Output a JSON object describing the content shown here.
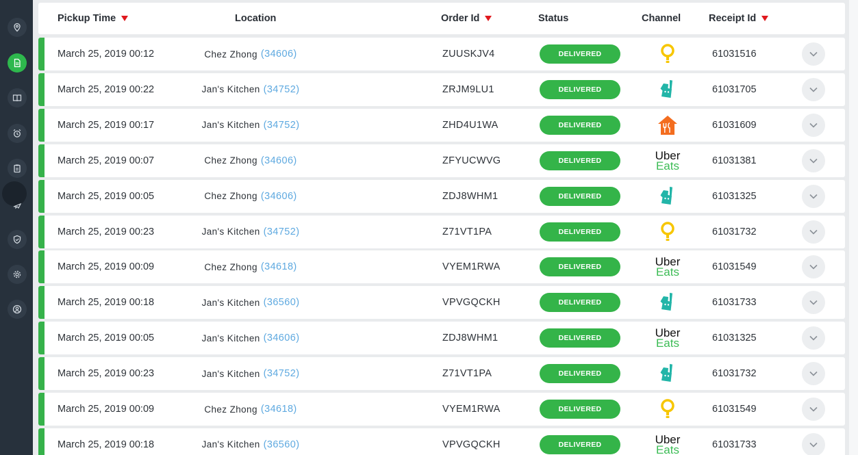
{
  "columns": {
    "pickup_time": "Pickup Time",
    "location": "Location",
    "order_id": "Order Id",
    "status": "Status",
    "channel": "Channel",
    "receipt_id": "Receipt Id"
  },
  "sidebar": {
    "items": [
      {
        "name": "location-pin-icon"
      },
      {
        "name": "orders-document-icon",
        "active": true
      },
      {
        "name": "menu-book-icon"
      },
      {
        "name": "alarm-clock-icon"
      },
      {
        "name": "clipboard-icon"
      },
      {
        "name": "plane-icon"
      },
      {
        "name": "shield-icon"
      },
      {
        "name": "settings-gear-icon"
      },
      {
        "name": "user-account-icon"
      }
    ]
  },
  "colors": {
    "accent_green": "#36b24a",
    "status_green": "#34b449",
    "link_blue": "#5ea9e0",
    "sort_red": "#e0191e",
    "postmates_yellow": "#f7c600",
    "deliveroo_teal": "#22b5a8",
    "thuisbezorgd_orange": "#f36d1f"
  },
  "orders": [
    {
      "time": "March 25, 2019 00:12",
      "location": "Chez Zhong",
      "location_id": "(34606)",
      "order_id": "ZUUSKJV4",
      "status": "DELIVERED",
      "channel": "postmates",
      "receipt_id": "61031516"
    },
    {
      "time": "March 25, 2019 00:22",
      "location": "Jan's Kitchen",
      "location_id": "(34752)",
      "order_id": "ZRJM9LU1",
      "status": "DELIVERED",
      "channel": "deliveroo",
      "receipt_id": "61031705"
    },
    {
      "time": "March 25, 2019 00:17",
      "location": "Jan's Kitchen",
      "location_id": "(34752)",
      "order_id": "ZHD4U1WA",
      "status": "DELIVERED",
      "channel": "thuisbezorgd",
      "receipt_id": "61031609"
    },
    {
      "time": "March 25, 2019 00:07",
      "location": "Chez Zhong",
      "location_id": "(34606)",
      "order_id": "ZFYUCWVG",
      "status": "DELIVERED",
      "channel": "ubereats",
      "receipt_id": "61031381"
    },
    {
      "time": "March 25, 2019 00:05",
      "location": "Chez Zhong",
      "location_id": "(34606)",
      "order_id": "ZDJ8WHM1",
      "status": "DELIVERED",
      "channel": "deliveroo",
      "receipt_id": "61031325"
    },
    {
      "time": "March 25, 2019 00:23",
      "location": "Jan's Kitchen",
      "location_id": "(34752)",
      "order_id": "Z71VT1PA",
      "status": "DELIVERED",
      "channel": "postmates",
      "receipt_id": "61031732"
    },
    {
      "time": "March 25, 2019 00:09",
      "location": "Chez Zhong",
      "location_id": "(34618)",
      "order_id": "VYEM1RWA",
      "status": "DELIVERED",
      "channel": "ubereats",
      "receipt_id": "61031549"
    },
    {
      "time": "March 25, 2019 00:18",
      "location": "Jan's Kitchen",
      "location_id": "(36560)",
      "order_id": "VPVGQCKH",
      "status": "DELIVERED",
      "channel": "deliveroo",
      "receipt_id": "61031733"
    },
    {
      "time": "March 25, 2019 00:05",
      "location": "Jan's Kitchen",
      "location_id": "(34606)",
      "order_id": "ZDJ8WHM1",
      "status": "DELIVERED",
      "channel": "ubereats",
      "receipt_id": "61031325"
    },
    {
      "time": "March 25, 2019 00:23",
      "location": "Jan's Kitchen",
      "location_id": "(34752)",
      "order_id": "Z71VT1PA",
      "status": "DELIVERED",
      "channel": "deliveroo",
      "receipt_id": "61031732"
    },
    {
      "time": "March 25, 2019 00:09",
      "location": "Chez Zhong",
      "location_id": "(34618)",
      "order_id": "VYEM1RWA",
      "status": "DELIVERED",
      "channel": "postmates",
      "receipt_id": "61031549"
    },
    {
      "time": "March 25, 2019 00:18",
      "location": "Jan's Kitchen",
      "location_id": "(36560)",
      "order_id": "VPVGQCKH",
      "status": "DELIVERED",
      "channel": "ubereats",
      "receipt_id": "61031733"
    }
  ],
  "uber_eats_logo": {
    "line1": "Uber",
    "line2": "Eats"
  }
}
